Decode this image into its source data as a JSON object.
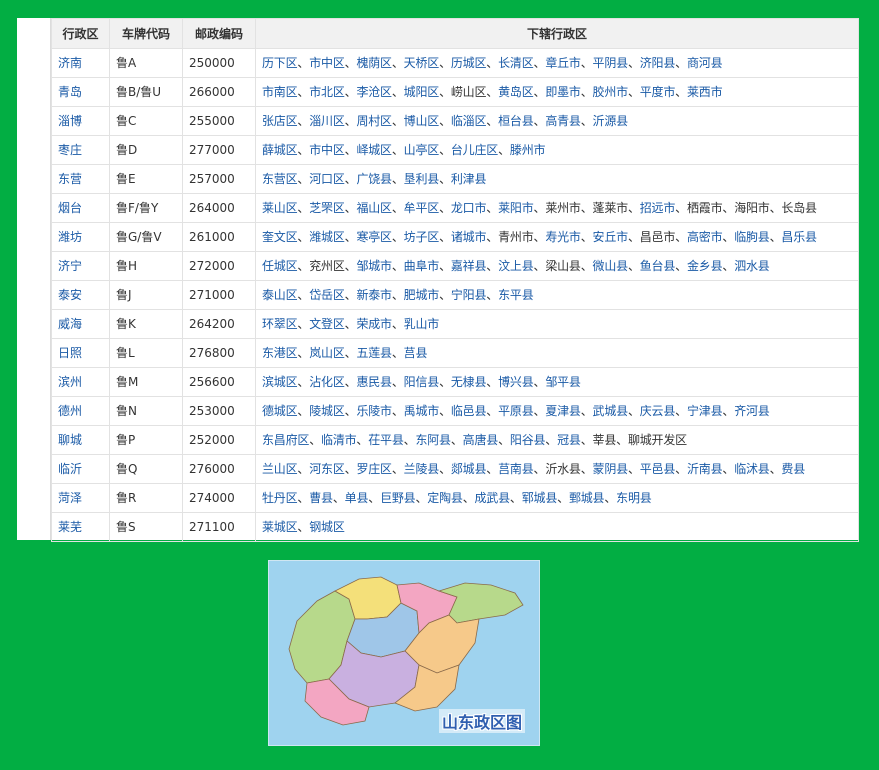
{
  "table": {
    "headers": {
      "city": "行政区",
      "plate": "车牌代码",
      "postcode": "邮政编码",
      "districts": "下辖行政区"
    },
    "rows": [
      {
        "city": "济南",
        "plate": "鲁A",
        "postcode": "250000",
        "districts": [
          [
            "历下区",
            1
          ],
          [
            "市中区",
            1
          ],
          [
            "槐荫区",
            1
          ],
          [
            "天桥区",
            1
          ],
          [
            "历城区",
            1
          ],
          [
            "长清区",
            1
          ],
          [
            "章丘市",
            1
          ],
          [
            "平阴县",
            1
          ],
          [
            "济阳县",
            1
          ],
          [
            "商河县",
            1
          ]
        ]
      },
      {
        "city": "青岛",
        "plate": "鲁B/鲁U",
        "postcode": "266000",
        "districts": [
          [
            "市南区",
            1
          ],
          [
            "市北区",
            1
          ],
          [
            "李沧区",
            1
          ],
          [
            "城阳区",
            1
          ],
          [
            "崂山区",
            0
          ],
          [
            "黄岛区",
            1
          ],
          [
            "即墨市",
            1
          ],
          [
            "胶州市",
            1
          ],
          [
            "平度市",
            1
          ],
          [
            "莱西市",
            1
          ]
        ]
      },
      {
        "city": "淄博",
        "plate": "鲁C",
        "postcode": "255000",
        "districts": [
          [
            "张店区",
            1
          ],
          [
            "淄川区",
            1
          ],
          [
            "周村区",
            1
          ],
          [
            "博山区",
            1
          ],
          [
            "临淄区",
            1
          ],
          [
            "桓台县",
            1
          ],
          [
            "高青县",
            1
          ],
          [
            "沂源县",
            1
          ]
        ]
      },
      {
        "city": "枣庄",
        "plate": "鲁D",
        "postcode": "277000",
        "districts": [
          [
            "薛城区",
            1
          ],
          [
            "市中区",
            1
          ],
          [
            "峄城区",
            1
          ],
          [
            "山亭区",
            1
          ],
          [
            "台儿庄区",
            1
          ],
          [
            "滕州市",
            1
          ]
        ]
      },
      {
        "city": "东营",
        "plate": "鲁E",
        "postcode": "257000",
        "districts": [
          [
            "东营区",
            1
          ],
          [
            "河口区",
            1
          ],
          [
            "广饶县",
            1
          ],
          [
            "垦利县",
            1
          ],
          [
            "利津县",
            1
          ]
        ]
      },
      {
        "city": "烟台",
        "plate": "鲁F/鲁Y",
        "postcode": "264000",
        "districts": [
          [
            "莱山区",
            1
          ],
          [
            "芝罘区",
            1
          ],
          [
            "福山区",
            1
          ],
          [
            "牟平区",
            1
          ],
          [
            "龙口市",
            1
          ],
          [
            "莱阳市",
            1
          ],
          [
            "莱州市",
            0
          ],
          [
            "蓬莱市",
            0
          ],
          [
            "招远市",
            1
          ],
          [
            "栖霞市",
            0
          ],
          [
            "海阳市",
            0
          ],
          [
            "长岛县",
            0
          ]
        ]
      },
      {
        "city": "潍坊",
        "plate": "鲁G/鲁V",
        "postcode": "261000",
        "districts": [
          [
            "奎文区",
            1
          ],
          [
            "潍城区",
            1
          ],
          [
            "寒亭区",
            1
          ],
          [
            "坊子区",
            1
          ],
          [
            "诸城市",
            1
          ],
          [
            "青州市",
            0
          ],
          [
            "寿光市",
            1
          ],
          [
            "安丘市",
            1
          ],
          [
            "昌邑市",
            0
          ],
          [
            "高密市",
            1
          ],
          [
            "临朐县",
            1
          ],
          [
            "昌乐县",
            1
          ]
        ]
      },
      {
        "city": "济宁",
        "plate": "鲁H",
        "postcode": "272000",
        "districts": [
          [
            "任城区",
            1
          ],
          [
            "兖州区",
            0
          ],
          [
            "邹城市",
            1
          ],
          [
            "曲阜市",
            1
          ],
          [
            "嘉祥县",
            1
          ],
          [
            "汶上县",
            1
          ],
          [
            "梁山县",
            0
          ],
          [
            "微山县",
            1
          ],
          [
            "鱼台县",
            1
          ],
          [
            "金乡县",
            1
          ],
          [
            "泗水县",
            1
          ]
        ]
      },
      {
        "city": "泰安",
        "plate": "鲁J",
        "postcode": "271000",
        "districts": [
          [
            "泰山区",
            1
          ],
          [
            "岱岳区",
            1
          ],
          [
            "新泰市",
            1
          ],
          [
            "肥城市",
            1
          ],
          [
            "宁阳县",
            1
          ],
          [
            "东平县",
            1
          ]
        ]
      },
      {
        "city": "威海",
        "plate": "鲁K",
        "postcode": "264200",
        "districts": [
          [
            "环翠区",
            1
          ],
          [
            "文登区",
            1
          ],
          [
            "荣成市",
            1
          ],
          [
            "乳山市",
            1
          ]
        ]
      },
      {
        "city": "日照",
        "plate": "鲁L",
        "postcode": "276800",
        "districts": [
          [
            "东港区",
            1
          ],
          [
            "岚山区",
            1
          ],
          [
            "五莲县",
            1
          ],
          [
            "莒县",
            1
          ]
        ]
      },
      {
        "city": "滨州",
        "plate": "鲁M",
        "postcode": "256600",
        "districts": [
          [
            "滨城区",
            1
          ],
          [
            "沾化区",
            1
          ],
          [
            "惠民县",
            1
          ],
          [
            "阳信县",
            1
          ],
          [
            "无棣县",
            1
          ],
          [
            "博兴县",
            1
          ],
          [
            "邹平县",
            1
          ]
        ]
      },
      {
        "city": "德州",
        "plate": "鲁N",
        "postcode": "253000",
        "districts": [
          [
            "德城区",
            1
          ],
          [
            "陵城区",
            1
          ],
          [
            "乐陵市",
            1
          ],
          [
            "禹城市",
            1
          ],
          [
            "临邑县",
            1
          ],
          [
            "平原县",
            1
          ],
          [
            "夏津县",
            1
          ],
          [
            "武城县",
            1
          ],
          [
            "庆云县",
            1
          ],
          [
            "宁津县",
            1
          ],
          [
            "齐河县",
            1
          ]
        ]
      },
      {
        "city": "聊城",
        "plate": "鲁P",
        "postcode": "252000",
        "districts": [
          [
            "东昌府区",
            1
          ],
          [
            "临清市",
            1
          ],
          [
            "茌平县",
            1
          ],
          [
            "东阿县",
            1
          ],
          [
            "高唐县",
            1
          ],
          [
            "阳谷县",
            1
          ],
          [
            "冠县",
            1
          ],
          [
            "莘县",
            0
          ],
          [
            "聊城开发区",
            0
          ]
        ]
      },
      {
        "city": "临沂",
        "plate": "鲁Q",
        "postcode": "276000",
        "districts": [
          [
            "兰山区",
            1
          ],
          [
            "河东区",
            1
          ],
          [
            "罗庄区",
            1
          ],
          [
            "兰陵县",
            1
          ],
          [
            "郯城县",
            1
          ],
          [
            "莒南县",
            1
          ],
          [
            "沂水县",
            0
          ],
          [
            "蒙阴县",
            1
          ],
          [
            "平邑县",
            1
          ],
          [
            "沂南县",
            1
          ],
          [
            "临沭县",
            1
          ],
          [
            "费县",
            1
          ]
        ]
      },
      {
        "city": "菏泽",
        "plate": "鲁R",
        "postcode": "274000",
        "districts": [
          [
            "牡丹区",
            1
          ],
          [
            "曹县",
            1
          ],
          [
            "单县",
            1
          ],
          [
            "巨野县",
            1
          ],
          [
            "定陶县",
            1
          ],
          [
            "成武县",
            1
          ],
          [
            "郓城县",
            1
          ],
          [
            "鄄城县",
            1
          ],
          [
            "东明县",
            1
          ]
        ]
      },
      {
        "city": "莱芜",
        "plate": "鲁S",
        "postcode": "271100",
        "districts": [
          [
            "莱城区",
            1
          ],
          [
            "钢城区",
            1
          ]
        ]
      }
    ],
    "separator": "、"
  },
  "map": {
    "caption": "山东政区图",
    "colors": {
      "water": "#9fd3ef",
      "land_a": "#f6c98a",
      "land_b": "#f3a6c2",
      "land_c": "#b7d98b",
      "land_d": "#c9b0e0",
      "land_e": "#f4e07a",
      "land_f": "#9fc6e8",
      "border": "#8a6a4a"
    }
  },
  "colors": {
    "page_bg": "#02ae43",
    "link": "#1a5aa6",
    "text": "#333333"
  }
}
